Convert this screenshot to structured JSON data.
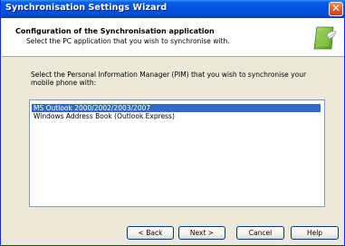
{
  "window": {
    "title": "Synchronisation Settings Wizard",
    "close_glyph": "✕"
  },
  "header": {
    "title": "Configuration of the Synchronisation application",
    "subtitle": "Select the PC application that you wish to synchronise with.",
    "icon": "sync-wizard-icon"
  },
  "body": {
    "instruction": "Select the Personal Information Manager (PIM) that you wish to synchronise your mobile phone with:"
  },
  "pim_list": {
    "items": [
      {
        "label": "MS Outlook 2000/2002/2003/2007",
        "selected": true
      },
      {
        "label": "Windows Address Book (Outlook Express)",
        "selected": false
      }
    ]
  },
  "buttons": {
    "back": "< Back",
    "next": "Next >",
    "cancel": "Cancel",
    "help": "Help"
  },
  "colors": {
    "titlebar": "#0054e3",
    "selection": "#316ac5",
    "dialog_bg": "#ece9d8",
    "close_button": "#e35b25"
  }
}
